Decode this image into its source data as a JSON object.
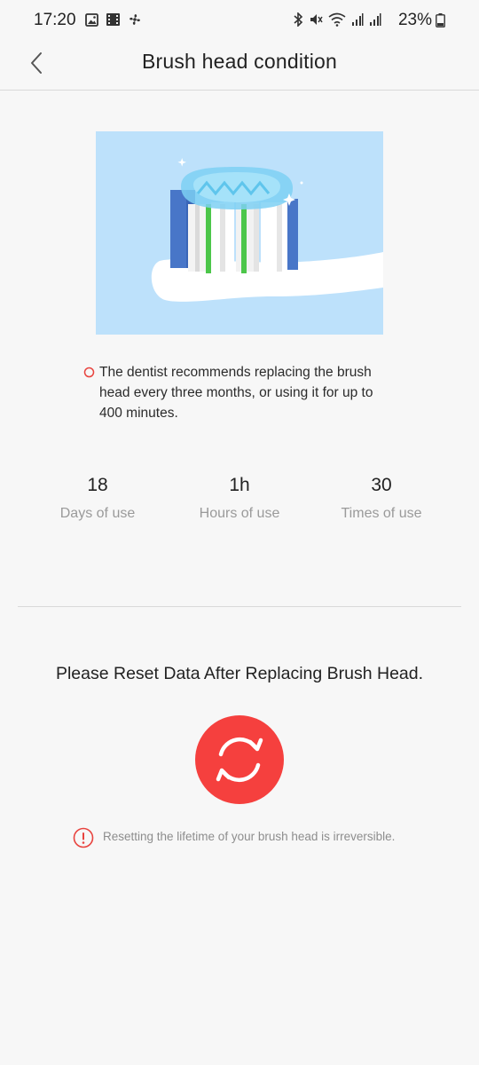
{
  "status_bar": {
    "time": "17:20",
    "battery": "23%",
    "left_icons": [
      "gallery-icon",
      "video-icon",
      "fan-icon"
    ],
    "right_icons": [
      "bluetooth-icon",
      "mute-icon",
      "wifi-icon",
      "signal-icon",
      "signal-icon",
      "battery-icon"
    ]
  },
  "header": {
    "title": "Brush head condition",
    "back_icon": "chevron-left-icon"
  },
  "hero": {
    "icon": "toothbrush-head-illustration",
    "background_color": "#bde1fb"
  },
  "recommendation": {
    "text": "The dentist recommends replacing the brush head every three months, or using it for up to 400 minutes.",
    "icon": "circle-bullet-icon",
    "icon_color": "#e8433e"
  },
  "stats": [
    {
      "value": "18",
      "label": "Days of use"
    },
    {
      "value": "1h",
      "label": "Hours of use"
    },
    {
      "value": "30",
      "label": "Times of use"
    }
  ],
  "reset": {
    "prompt": "Please Reset Data After Replacing Brush Head.",
    "button_icon": "refresh-icon",
    "button_color": "#f5403e",
    "warning_icon": "alert-circle-icon",
    "warning_text": "Resetting the lifetime of your brush head is irreversible."
  }
}
